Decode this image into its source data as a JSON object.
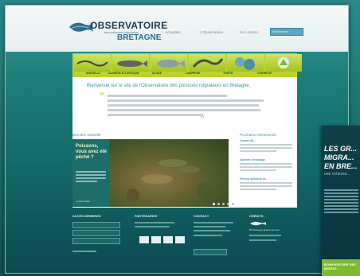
{
  "header": {
    "logo_word": "OBSERVATOIRE",
    "logo_sub": "des poissons migrateurs",
    "logo_region": "BRETAGNE",
    "nav": [
      "Actualités",
      "L'Observatoire",
      "Nos actions"
    ],
    "search_placeholder": "Rechercher"
  },
  "categories": [
    "ANGUILLE",
    "SAUMON ATLANTIQUE",
    "ALOSE",
    "LAMPROIE",
    "TRUITE",
    "CARRELET"
  ],
  "welcome": "Bienvenue sur le site de l'Observatoire des poissons migrateurs en Bretagne,",
  "sections": {
    "left_title": "Dernière nouvelle",
    "right_title": "Prochains événements"
  },
  "feature": {
    "title": "Poissons, vous avez été pêché ?",
    "link": "» Lire la suite"
  },
  "news": [
    {
      "title": "Ouvrez du..."
    },
    {
      "title": "Journée d'échange"
    },
    {
      "title": "Pêches sciences et..."
    }
  ],
  "footer": {
    "col1": "ACCÈS MEMBRES",
    "col2": "PARTENAIRES",
    "col3": "CONTACT",
    "col4": "CRÉDITS",
    "col4_item": "BP Bretagne Environnement"
  },
  "ad": {
    "headline": "LES GR... MIGRA... EN BRE...",
    "sub": "une richesse...",
    "footer": "BONAVENTURE DES MIGRAT..."
  },
  "colors": {
    "accent": "#bcd32e",
    "teal": "#1f7f7c",
    "link": "#3a8fb2"
  }
}
